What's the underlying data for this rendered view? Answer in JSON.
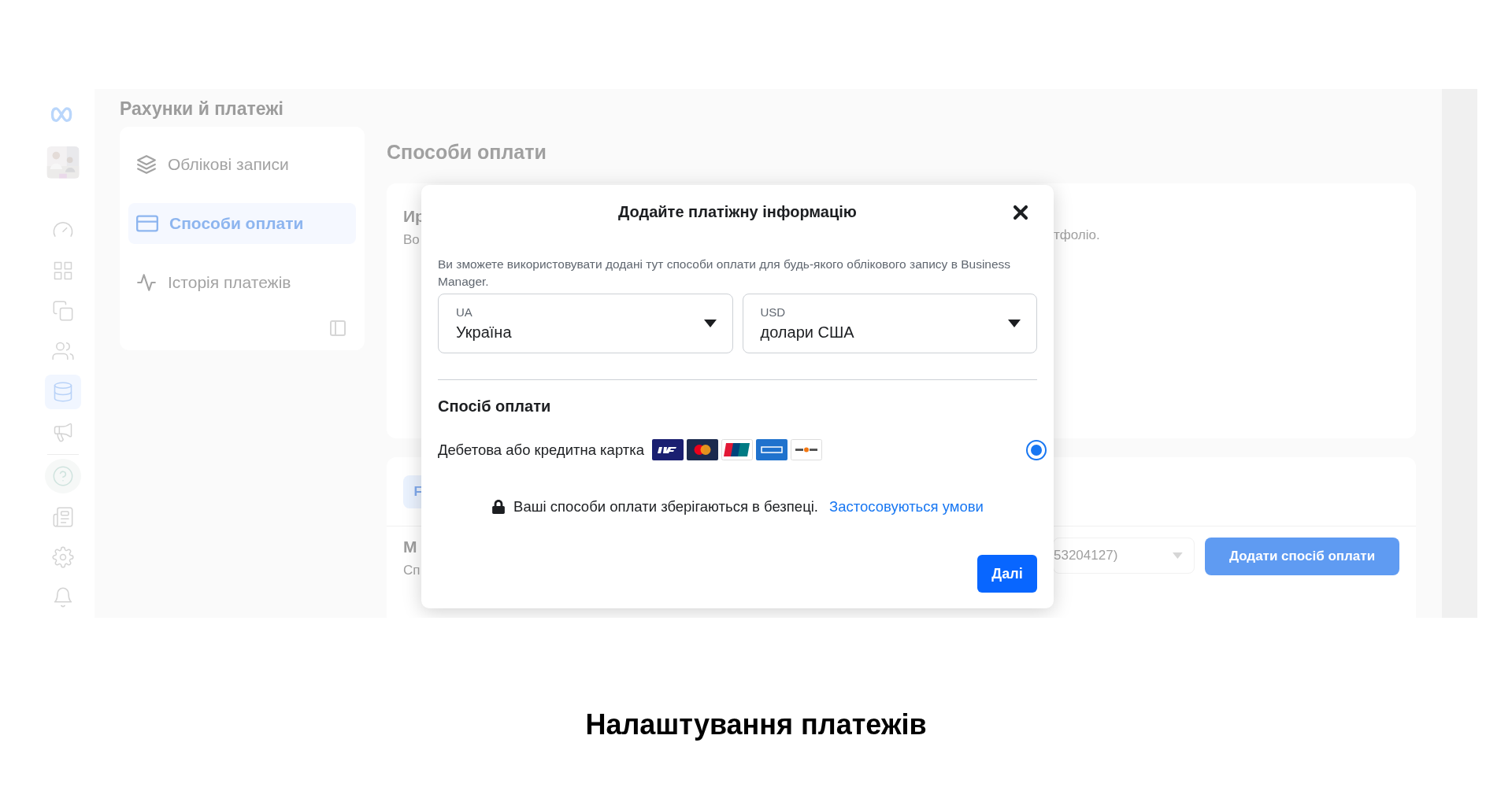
{
  "rail": {
    "items": [
      {
        "kind": "dashboard",
        "selected": false
      },
      {
        "kind": "table",
        "selected": false
      },
      {
        "kind": "documents",
        "selected": false
      },
      {
        "kind": "people",
        "selected": false
      },
      {
        "kind": "billing",
        "selected": true
      },
      {
        "kind": "ads",
        "selected": false
      },
      {
        "kind": "help",
        "selected": false
      },
      {
        "kind": "news",
        "selected": false
      },
      {
        "kind": "settings",
        "selected": false
      },
      {
        "kind": "notifications",
        "selected": false
      }
    ]
  },
  "header": {
    "title": "Рахунки й платежі"
  },
  "nav": {
    "items": [
      {
        "kind": "accounts",
        "label": "Облікові записи",
        "selected": false
      },
      {
        "kind": "payment_methods",
        "label": "Способи оплати",
        "selected": true
      },
      {
        "kind": "history",
        "label": "Історія платежів",
        "selected": false
      }
    ]
  },
  "content": {
    "title": "Способи оплати",
    "card_1": {
      "title_fragment": "Ир",
      "subtitle_fragment": "Во",
      "subtitle_end": "тфоліо."
    },
    "card_2": {
      "tab_fragment": "F",
      "section_fragment": "М",
      "section_sub_fragment": "Сп",
      "account_select": "53204127)",
      "add_button": "Додати спосіб оплати"
    }
  },
  "dialog": {
    "title": "Додайте платіжну інформацію",
    "description": "Ви зможете використовувати додані тут способи оплати для будь-якого облікового запису в Business Manager.",
    "country": {
      "label": "UA",
      "value": "Україна"
    },
    "currency": {
      "label": "USD",
      "value": "долари США"
    },
    "section_title": "Спосіб оплати",
    "methods": [
      {
        "label": "Дебетова або кредитна картка",
        "selected": true,
        "cards": [
          {
            "kind": "visa"
          },
          {
            "kind": "mastercard"
          },
          {
            "kind": "unionpay"
          },
          {
            "kind": "amex"
          },
          {
            "kind": "discover"
          }
        ]
      }
    ],
    "security_note": "Ваші способи оплати зберігаються в безпеці.",
    "terms_link": "Застосовуються умови",
    "next_button": "Далі"
  },
  "caption": "Налаштування платежів"
}
